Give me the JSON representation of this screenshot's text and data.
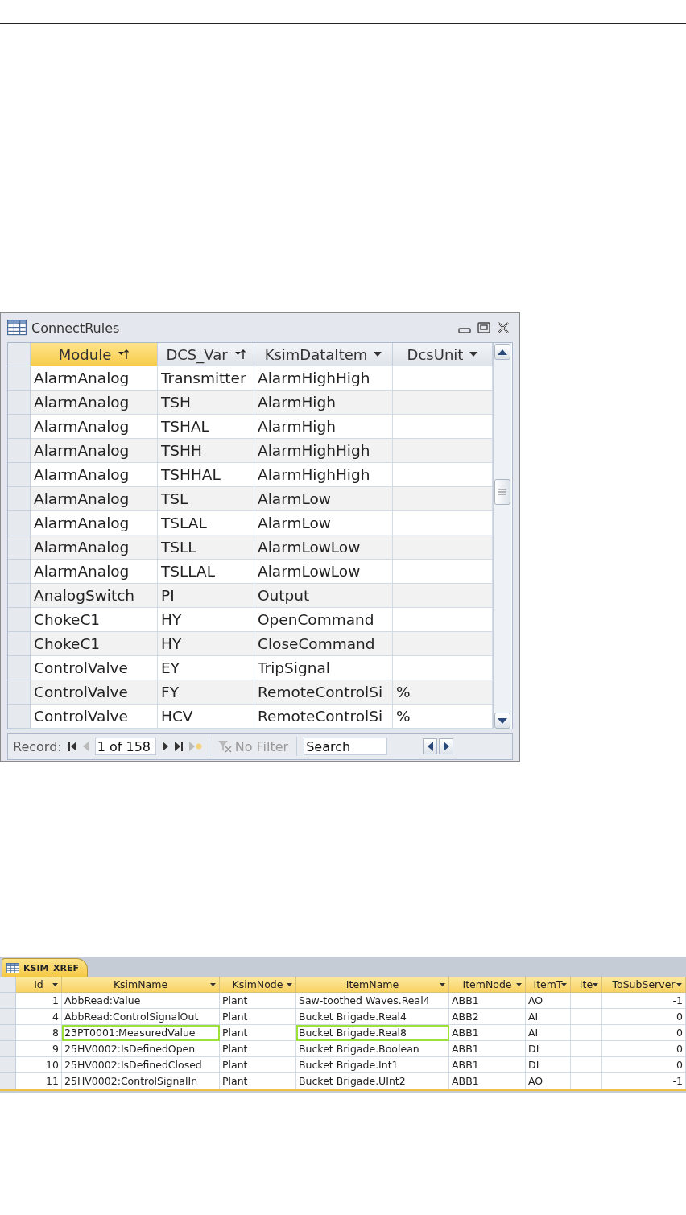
{
  "connect_rules": {
    "title": "ConnectRules",
    "columns": [
      {
        "label": "Module",
        "selected": true,
        "sorted": true
      },
      {
        "label": "DCS_Var",
        "selected": false,
        "sorted": true
      },
      {
        "label": "KsimDataItem",
        "selected": false,
        "sorted": false
      },
      {
        "label": "DcsUnit",
        "selected": false,
        "sorted": false
      }
    ],
    "rows": [
      [
        "AlarmAnalog",
        "Transmitter",
        "AlarmHighHigh",
        ""
      ],
      [
        "AlarmAnalog",
        "TSH",
        "AlarmHigh",
        ""
      ],
      [
        "AlarmAnalog",
        "TSHAL",
        "AlarmHigh",
        ""
      ],
      [
        "AlarmAnalog",
        "TSHH",
        "AlarmHighHigh",
        ""
      ],
      [
        "AlarmAnalog",
        "TSHHAL",
        "AlarmHighHigh",
        ""
      ],
      [
        "AlarmAnalog",
        "TSL",
        "AlarmLow",
        ""
      ],
      [
        "AlarmAnalog",
        "TSLAL",
        "AlarmLow",
        ""
      ],
      [
        "AlarmAnalog",
        "TSLL",
        "AlarmLowLow",
        ""
      ],
      [
        "AlarmAnalog",
        "TSLLAL",
        "AlarmLowLow",
        ""
      ],
      [
        "AnalogSwitch",
        "PI",
        "Output",
        ""
      ],
      [
        "ChokeC1",
        "HY",
        "OpenCommand",
        ""
      ],
      [
        "ChokeC1",
        "HY",
        "CloseCommand",
        ""
      ],
      [
        "ControlValve",
        "EY",
        "TripSignal",
        ""
      ],
      [
        "ControlValve",
        "FY",
        "RemoteControlSi",
        "%"
      ],
      [
        "ControlValve",
        "HCV",
        "RemoteControlSi",
        "%"
      ]
    ],
    "navigation": {
      "label": "Record:",
      "position": "1 of 158",
      "filter": "No Filter",
      "search_placeholder": "Search"
    }
  },
  "ksim_xref": {
    "tab": "KSIM_XREF",
    "columns": [
      "Id",
      "KsimName",
      "KsimNode",
      "ItemName",
      "ItemNode",
      "ItemT",
      "Ite",
      "ToSubServer"
    ],
    "rows": [
      {
        "cells": [
          {
            "text": "1",
            "outlined": false
          },
          {
            "text": "AbbRead:Value",
            "outlined": false
          },
          {
            "text": "Plant",
            "outlined": false
          },
          {
            "text": "Saw-toothed Waves.Real4",
            "outlined": false
          },
          {
            "text": "ABB1",
            "outlined": false
          },
          {
            "text": "AO",
            "outlined": false
          },
          {
            "text": "",
            "outlined": false
          },
          {
            "text": "-1",
            "outlined": false
          }
        ]
      },
      {
        "cells": [
          {
            "text": "4",
            "outlined": false
          },
          {
            "text": "AbbRead:ControlSignalOut",
            "outlined": false
          },
          {
            "text": "Plant",
            "outlined": false
          },
          {
            "text": "Bucket Brigade.Real4",
            "outlined": false
          },
          {
            "text": "ABB2",
            "outlined": false
          },
          {
            "text": "AI",
            "outlined": false
          },
          {
            "text": "",
            "outlined": false
          },
          {
            "text": "0",
            "outlined": false
          }
        ]
      },
      {
        "cells": [
          {
            "text": "8",
            "outlined": false
          },
          {
            "text": "23PT0001:MeasuredValue",
            "outlined": true
          },
          {
            "text": "Plant",
            "outlined": false
          },
          {
            "text": "Bucket Brigade.Real8",
            "outlined": true
          },
          {
            "text": "ABB1",
            "outlined": false
          },
          {
            "text": "AI",
            "outlined": false
          },
          {
            "text": "",
            "outlined": false
          },
          {
            "text": "0",
            "outlined": false
          }
        ]
      },
      {
        "cells": [
          {
            "text": "9",
            "outlined": false
          },
          {
            "text": "25HV0002:IsDefinedOpen",
            "outlined": false
          },
          {
            "text": "Plant",
            "outlined": false
          },
          {
            "text": "Bucket Brigade.Boolean",
            "outlined": false
          },
          {
            "text": "ABB1",
            "outlined": false
          },
          {
            "text": "DI",
            "outlined": false
          },
          {
            "text": "",
            "outlined": false
          },
          {
            "text": "0",
            "outlined": false
          }
        ]
      },
      {
        "cells": [
          {
            "text": "10",
            "outlined": false
          },
          {
            "text": "25HV0002:IsDefinedClosed",
            "outlined": false
          },
          {
            "text": "Plant",
            "outlined": false
          },
          {
            "text": "Bucket Brigade.Int1",
            "outlined": false
          },
          {
            "text": "ABB1",
            "outlined": false
          },
          {
            "text": "DI",
            "outlined": false
          },
          {
            "text": "",
            "outlined": false
          },
          {
            "text": "0",
            "outlined": false
          }
        ]
      },
      {
        "cells": [
          {
            "text": "11",
            "outlined": false
          },
          {
            "text": "25HV0002:ControlSignalIn",
            "outlined": false
          },
          {
            "text": "Plant",
            "outlined": false
          },
          {
            "text": "Bucket Brigade.UInt2",
            "outlined": false
          },
          {
            "text": "ABB1",
            "outlined": false
          },
          {
            "text": "AO",
            "outlined": false
          },
          {
            "text": "",
            "outlined": false
          },
          {
            "text": "-1",
            "outlined": false
          }
        ]
      }
    ]
  }
}
